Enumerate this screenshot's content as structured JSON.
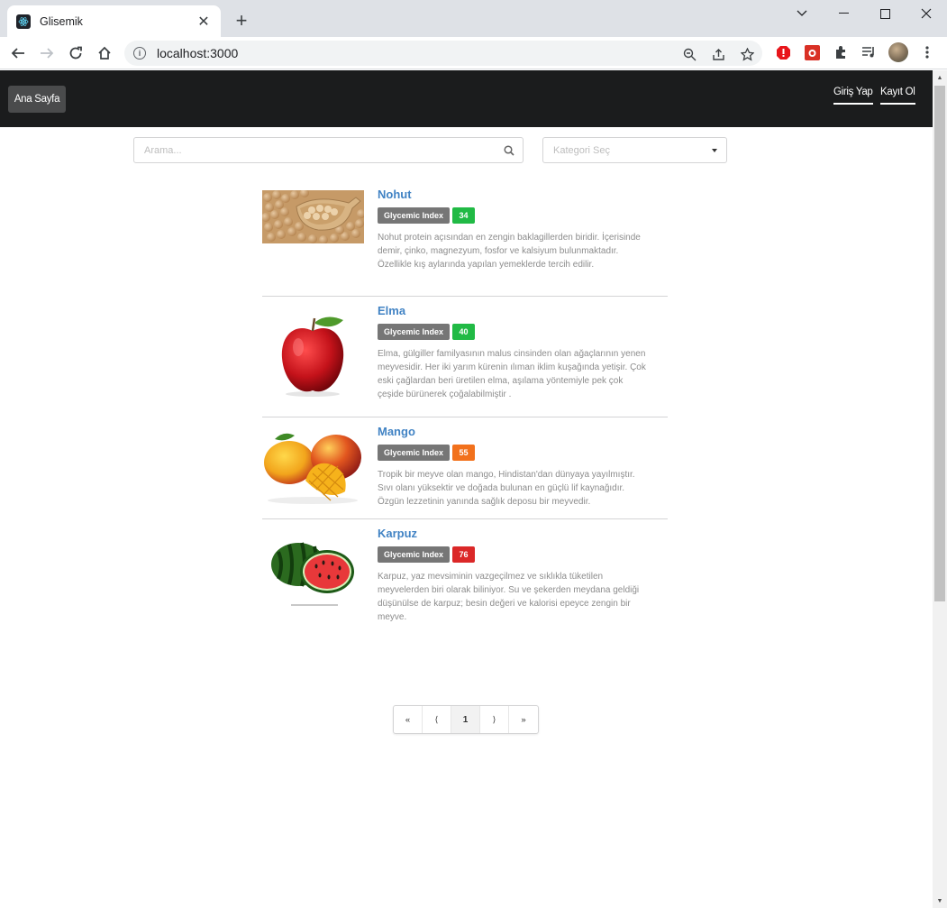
{
  "browser": {
    "tab_title": "Glisemik",
    "tab_close": "✕",
    "new_tab": "+",
    "url": "localhost:3000"
  },
  "navbar": {
    "home_label": "Ana Sayfa",
    "login_label": "Giriş Yap",
    "register_label": "Kayıt Ol"
  },
  "filters": {
    "search_placeholder": "Arama...",
    "category_placeholder": "Kategori Seç"
  },
  "items": [
    {
      "name": "Nohut",
      "badge_label": "Glycemic Index",
      "gi": "34",
      "gi_color": "#21ba45",
      "description": "Nohut protein açısından en zengin baklagillerden biridir. İçerisinde demir, çinko, magnezyum, fosfor ve kalsiyum bulunmaktadır. Özellikle kış aylarında yapılan yemeklerde tercih edilir."
    },
    {
      "name": "Elma",
      "badge_label": "Glycemic Index",
      "gi": "40",
      "gi_color": "#21ba45",
      "description": "Elma, gülgiller familyasının malus cinsinden olan ağaçlarının yenen meyvesidir. Her iki yarım kürenin ılıman iklim kuşağında yetişir. Çok eski çağlardan beri üretilen elma, aşılama yöntemiyle pek çok çeşide bürünerek çoğalabilmiştir ."
    },
    {
      "name": "Mango",
      "badge_label": "Glycemic Index",
      "gi": "55",
      "gi_color": "#f2711c",
      "description": "Tropik bir meyve olan mango, Hindistan'dan dünyaya yayılmıştır. Sıvı olanı yüksektir ve doğada bulunan en güçlü lif kaynağıdır. Özgün lezzetinin yanında sağlık deposu bir meyvedir."
    },
    {
      "name": "Karpuz",
      "badge_label": "Glycemic Index",
      "gi": "76",
      "gi_color": "#db2828",
      "description": "Karpuz, yaz mevsiminin vazgeçilmez ve sıklıkla tüketilen meyvelerden biri olarak biliniyor. Su ve şekerden meydana geldiği düşünülse de karpuz; besin değeri ve kalorisi epeyce zengin bir meyve."
    }
  ],
  "pagination": {
    "first": "«",
    "prev": "⟨",
    "current": "1",
    "next": "⟩",
    "last": "»"
  }
}
